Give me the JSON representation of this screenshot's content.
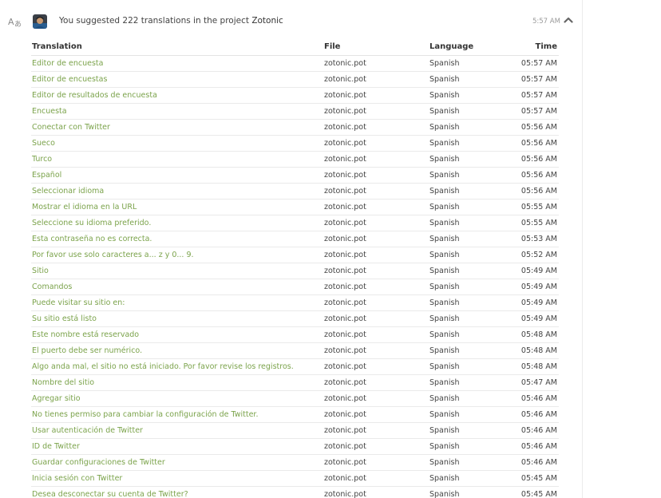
{
  "activity": {
    "message_prefix": "You suggested 222 translations in the project",
    "project_name": "Zotonic",
    "time": "5:57 AM"
  },
  "icons": {
    "activity_type": "translate-icon",
    "avatar": "user-avatar",
    "collapse": "chevron-up-icon"
  },
  "colors": {
    "link_green": "#7ba34b",
    "divider": "#eaeaea"
  },
  "table": {
    "headers": {
      "translation": "Translation",
      "file": "File",
      "language": "Language",
      "time": "Time"
    },
    "rows": [
      {
        "translation": "Editor de encuesta",
        "file": "zotonic.pot",
        "language": "Spanish",
        "time": "05:57 AM"
      },
      {
        "translation": "Editor de encuestas",
        "file": "zotonic.pot",
        "language": "Spanish",
        "time": "05:57 AM"
      },
      {
        "translation": "Editor de resultados de encuesta",
        "file": "zotonic.pot",
        "language": "Spanish",
        "time": "05:57 AM"
      },
      {
        "translation": "Encuesta",
        "file": "zotonic.pot",
        "language": "Spanish",
        "time": "05:57 AM"
      },
      {
        "translation": "Conectar con Twitter",
        "file": "zotonic.pot",
        "language": "Spanish",
        "time": "05:56 AM"
      },
      {
        "translation": "Sueco",
        "file": "zotonic.pot",
        "language": "Spanish",
        "time": "05:56 AM"
      },
      {
        "translation": "Turco",
        "file": "zotonic.pot",
        "language": "Spanish",
        "time": "05:56 AM"
      },
      {
        "translation": "Español",
        "file": "zotonic.pot",
        "language": "Spanish",
        "time": "05:56 AM"
      },
      {
        "translation": "Seleccionar idioma",
        "file": "zotonic.pot",
        "language": "Spanish",
        "time": "05:56 AM"
      },
      {
        "translation": "Mostrar el idioma en la URL",
        "file": "zotonic.pot",
        "language": "Spanish",
        "time": "05:55 AM"
      },
      {
        "translation": "Seleccione su idioma preferido.",
        "file": "zotonic.pot",
        "language": "Spanish",
        "time": "05:55 AM"
      },
      {
        "translation": "Esta contraseña no es correcta.",
        "file": "zotonic.pot",
        "language": "Spanish",
        "time": "05:53 AM"
      },
      {
        "translation": "Por favor use solo caracteres a... z y 0... 9.",
        "file": "zotonic.pot",
        "language": "Spanish",
        "time": "05:52 AM"
      },
      {
        "translation": "Sitio",
        "file": "zotonic.pot",
        "language": "Spanish",
        "time": "05:49 AM"
      },
      {
        "translation": "Comandos",
        "file": "zotonic.pot",
        "language": "Spanish",
        "time": "05:49 AM"
      },
      {
        "translation": "Puede visitar su sitio en:",
        "file": "zotonic.pot",
        "language": "Spanish",
        "time": "05:49 AM"
      },
      {
        "translation": "Su sitio está listo",
        "file": "zotonic.pot",
        "language": "Spanish",
        "time": "05:49 AM"
      },
      {
        "translation": "Este nombre está reservado",
        "file": "zotonic.pot",
        "language": "Spanish",
        "time": "05:48 AM"
      },
      {
        "translation": "El puerto debe ser numérico.",
        "file": "zotonic.pot",
        "language": "Spanish",
        "time": "05:48 AM"
      },
      {
        "translation": "Algo anda mal, el sitio no está iniciado. Por favor revise los registros.",
        "file": "zotonic.pot",
        "language": "Spanish",
        "time": "05:48 AM"
      },
      {
        "translation": "Nombre del sitio",
        "file": "zotonic.pot",
        "language": "Spanish",
        "time": "05:47 AM"
      },
      {
        "translation": "Agregar sitio",
        "file": "zotonic.pot",
        "language": "Spanish",
        "time": "05:46 AM"
      },
      {
        "translation": "No tienes permiso para cambiar la configuración de Twitter.",
        "file": "zotonic.pot",
        "language": "Spanish",
        "time": "05:46 AM"
      },
      {
        "translation": "Usar autenticación de Twitter",
        "file": "zotonic.pot",
        "language": "Spanish",
        "time": "05:46 AM"
      },
      {
        "translation": "ID de Twitter",
        "file": "zotonic.pot",
        "language": "Spanish",
        "time": "05:46 AM"
      },
      {
        "translation": "Guardar configuraciones de Twitter",
        "file": "zotonic.pot",
        "language": "Spanish",
        "time": "05:46 AM"
      },
      {
        "translation": "Inicia sesión con Twitter",
        "file": "zotonic.pot",
        "language": "Spanish",
        "time": "05:45 AM"
      },
      {
        "translation": "Desea desconectar su cuenta de Twitter?",
        "file": "zotonic.pot",
        "language": "Spanish",
        "time": "05:45 AM"
      }
    ]
  }
}
